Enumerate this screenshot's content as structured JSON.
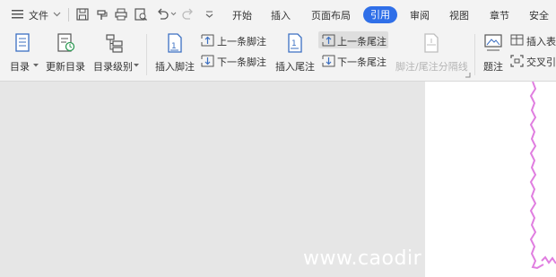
{
  "menubar": {
    "file_label": "文件",
    "tabs": [
      "开始",
      "插入",
      "页面布局",
      "引用",
      "审阅",
      "视图",
      "章节",
      "安全"
    ],
    "active_tab": "引用"
  },
  "ribbon": {
    "toc_label": "目录",
    "update_toc_label": "更新目录",
    "toc_level_label": "目录级别",
    "insert_footnote_label": "插入脚注",
    "prev_footnote_label": "上一条脚注",
    "next_footnote_label": "下一条脚注",
    "insert_endnote_label": "插入尾注",
    "prev_endnote_label": "上一条尾注",
    "next_endnote_label": "下一条尾注",
    "separator_label": "脚注/尾注分隔线",
    "caption_label": "题注",
    "insert_table_label": "插入表",
    "cross_ref_label": "交叉引"
  },
  "watermark": "www.caodir",
  "colors": {
    "accent": "#2f6fe8",
    "doc_border": "#e07ee0"
  }
}
